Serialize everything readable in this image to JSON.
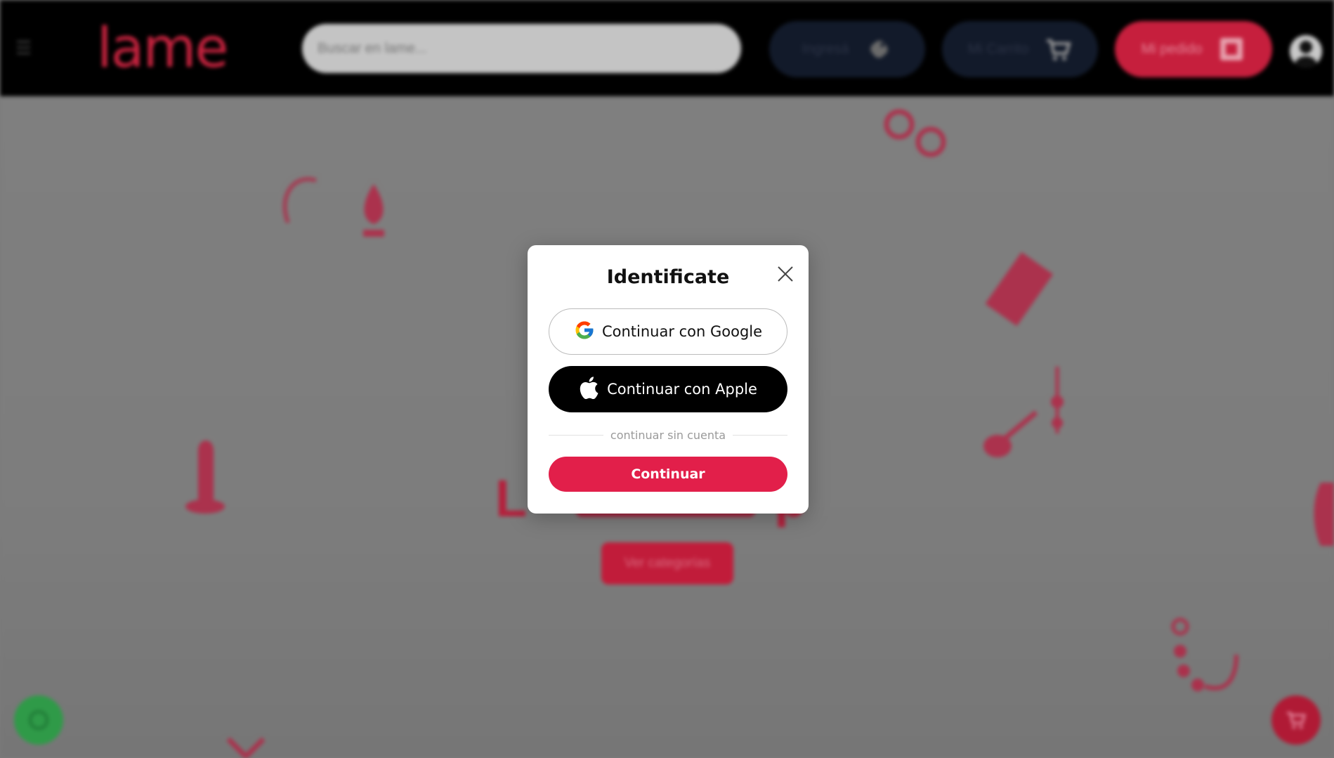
{
  "header": {
    "logo_text": "lame",
    "search_placeholder": "Buscar en lame...",
    "ingresa_label": "Ingresá",
    "cart_label": "Mi Carrito",
    "order_label": "Mi pedido"
  },
  "hero": {
    "title_left": "L",
    "title_right": "p",
    "categories_button": "Ver categorías"
  },
  "modal": {
    "title": "Identificate",
    "google_button": "Continuar con Google",
    "apple_button": "Continuar con Apple",
    "divider_text": "continuar sin cuenta",
    "continue_button": "Continuar"
  },
  "colors": {
    "brand_red": "#e21f4a",
    "topbar": "#000000",
    "overlay": "#7a7a7a"
  },
  "icons": {
    "menu": "menu-icon",
    "tag": "tag-icon",
    "cart": "cart-icon",
    "order": "order-icon",
    "user": "user-icon",
    "close": "close-icon",
    "google": "google-icon",
    "apple": "apple-icon",
    "whatsapp": "whatsapp-icon",
    "cart_fab": "cart-fab-icon"
  }
}
